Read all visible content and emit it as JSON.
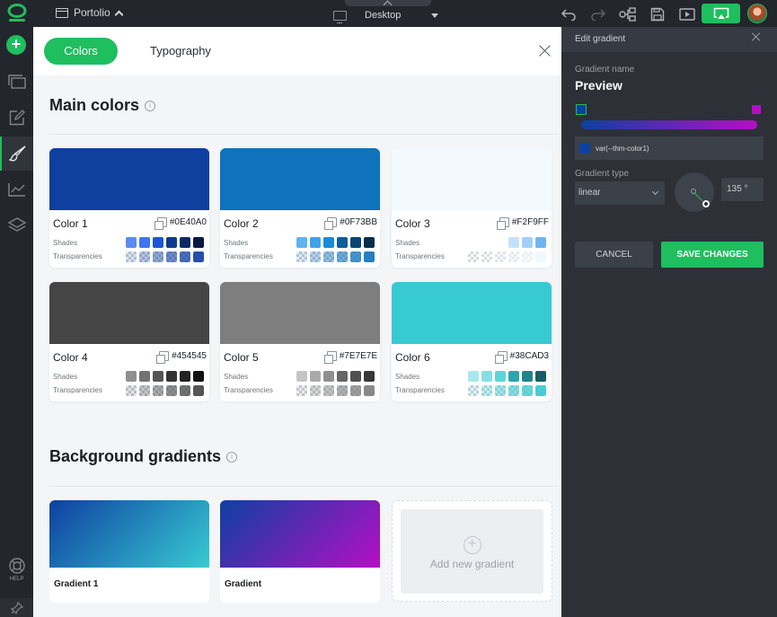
{
  "topbar": {
    "site_name": "Portolio",
    "device": "Desktop"
  },
  "sidebar": {
    "help_label": "HELP"
  },
  "main": {
    "tabs": [
      {
        "label": "Colors"
      },
      {
        "label": "Typography"
      }
    ],
    "main_colors_title": "Main colors",
    "shades_label": "Shades",
    "transparencies_label": "Transparencies",
    "colors": [
      {
        "name": "Color 1",
        "hex": "#0E40A0",
        "swatch": "#0e40a0",
        "shades": [
          "#5b8cf0",
          "#3f75ee",
          "#1d55d8",
          "#0f3a8a",
          "#0a2a66",
          "#061a40"
        ],
        "trans": [
          "#0e40a0",
          "#0e40a0",
          "#0e40a0",
          "#0e40a0",
          "#0e40a0"
        ]
      },
      {
        "name": "Color 2",
        "hex": "#0F73BB",
        "swatch": "#0f73bb",
        "shades": [
          "#5fb3ee",
          "#3fa2ea",
          "#1a8ad8",
          "#0f5e99",
          "#0b4673",
          "#062d4b"
        ],
        "trans": [
          "#0f73bb",
          "#0f73bb",
          "#0f73bb",
          "#0f73bb",
          "#0f73bb"
        ]
      },
      {
        "name": "Color 3",
        "hex": "#F2F9FF",
        "swatch": "#f2f9ff",
        "shades": [
          "#c4e1fb",
          "#a1cff8",
          "#6fb5f2"
        ],
        "trans": [
          "#d9e9f7",
          "#d9e9f7",
          "#d9e9f7",
          "#d9e9f7",
          "#d9e9f7"
        ]
      },
      {
        "name": "Color 4",
        "hex": "#454545",
        "swatch": "#454545",
        "shades": [
          "#8f8f8f",
          "#737373",
          "#555555",
          "#333333",
          "#222222",
          "#111111"
        ],
        "trans": [
          "#454545",
          "#454545",
          "#454545",
          "#454545",
          "#454545"
        ]
      },
      {
        "name": "Color 5",
        "hex": "#7E7E7E",
        "swatch": "#7e7e7e",
        "shades": [
          "#c4c4c4",
          "#aaaaaa",
          "#909090",
          "#666666",
          "#4f4f4f",
          "#383838"
        ],
        "trans": [
          "#7e7e7e",
          "#7e7e7e",
          "#7e7e7e",
          "#7e7e7e",
          "#7e7e7e"
        ]
      },
      {
        "name": "Color 6",
        "hex": "#38CAD3",
        "swatch": "#38cad3",
        "shades": [
          "#a8e8ec",
          "#86dfe4",
          "#5ed4db",
          "#2aa6ae",
          "#1f858c",
          "#155e63"
        ],
        "trans": [
          "#38cad3",
          "#38cad3",
          "#38cad3",
          "#38cad3",
          "#38cad3"
        ]
      }
    ],
    "gradients_title": "Background gradients",
    "gradients": [
      {
        "name": "Gradient 1",
        "from": "#0e40a0",
        "to": "#38cad3"
      },
      {
        "name": "Gradient",
        "from": "#0e40a0",
        "to": "#b40fc4"
      }
    ],
    "add_gradient_label": "Add new gradient"
  },
  "edit_gradient": {
    "panel_title": "Edit gradient",
    "name_label": "Gradient name",
    "name_value": "Preview",
    "stop_colors": [
      "#0e40a0",
      "#b40fc4"
    ],
    "stop_variable": "var(--thm-color1)",
    "type_label": "Gradient type",
    "type_value": "linear",
    "angle_value": "135 °",
    "cancel_label": "CANCEL",
    "save_label": "SAVE CHANGES"
  }
}
